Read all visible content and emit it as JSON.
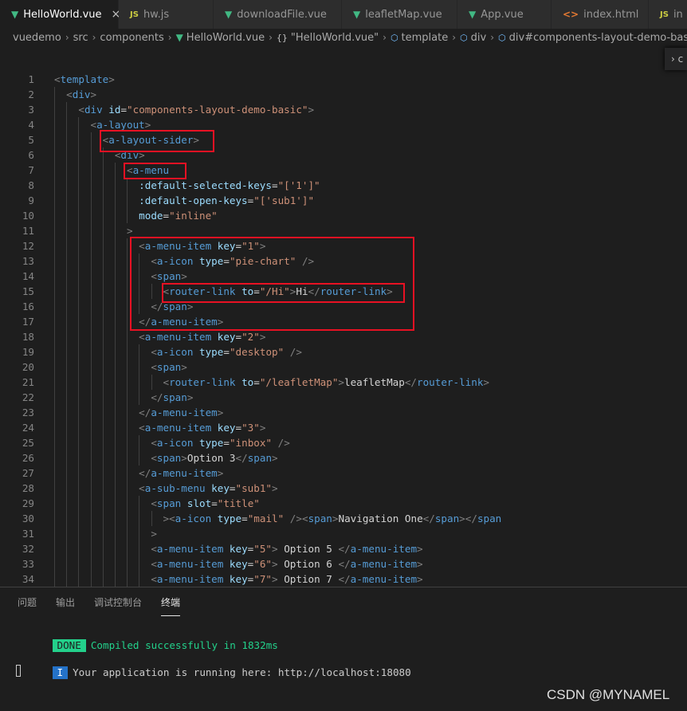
{
  "tabs": [
    {
      "label": "HelloWorld.vue",
      "icon": "vue-file-icon",
      "active": true
    },
    {
      "label": "hw.js",
      "icon": "js-file-icon",
      "active": false
    },
    {
      "label": "downloadFile.vue",
      "icon": "vue-file-icon",
      "active": false
    },
    {
      "label": "leafletMap.vue",
      "icon": "vue-file-icon",
      "active": false
    },
    {
      "label": "App.vue",
      "icon": "vue-file-icon",
      "active": false
    },
    {
      "label": "index.html",
      "icon": "html-file-icon",
      "active": false
    },
    {
      "label": "in",
      "icon": "js-file-icon",
      "active": false
    }
  ],
  "breadcrumb": {
    "items": [
      "vuedemo",
      "src",
      "components",
      "HelloWorld.vue",
      "\"HelloWorld.vue\"",
      "template",
      "div",
      "div#components-layout-demo-basic"
    ]
  },
  "sticky_widget": {
    "label": "c"
  },
  "editor": {
    "line_numbers": [
      "1",
      "2",
      "3",
      "4",
      "5",
      "6",
      "7",
      "8",
      "9",
      "10",
      "11",
      "12",
      "13",
      "14",
      "15",
      "16",
      "17",
      "18",
      "19",
      "20",
      "21",
      "22",
      "23",
      "24",
      "25",
      "26",
      "27",
      "28",
      "29",
      "30",
      "31",
      "32",
      "33",
      "34"
    ],
    "lines": [
      "<template>",
      "  <div>",
      "    <div id=\"components-layout-demo-basic\">",
      "      <a-layout>",
      "        <a-layout-sider>",
      "          <div>",
      "            <a-menu",
      "              :default-selected-keys=\"['1']\"",
      "              :default-open-keys=\"['sub1']\"",
      "              mode=\"inline\"",
      "            >",
      "              <a-menu-item key=\"1\">",
      "                <a-icon type=\"pie-chart\" />",
      "                <span>",
      "                  <router-link to=\"/Hi\">Hi</router-link>",
      "                </span>",
      "              </a-menu-item>",
      "              <a-menu-item key=\"2\">",
      "                <a-icon type=\"desktop\" />",
      "                <span>",
      "                  <router-link to=\"/leafletMap\">leafletMap</router-link>",
      "                </span>",
      "              </a-menu-item>",
      "              <a-menu-item key=\"3\">",
      "                <a-icon type=\"inbox\" />",
      "                <span>Option 3</span>",
      "              </a-menu-item>",
      "              <a-sub-menu key=\"sub1\">",
      "                <span slot=\"title\"",
      "                  ><a-icon type=\"mail\" /><span>Navigation One</span></span",
      "                >",
      "                <a-menu-item key=\"5\"> Option 5 </a-menu-item>",
      "                <a-menu-item key=\"6\"> Option 6 </a-menu-item>",
      "                <a-menu-item key=\"7\"> Option 7 </a-menu-item>"
    ]
  },
  "panel": {
    "tabs": [
      {
        "label": "问题",
        "active": false
      },
      {
        "label": "输出",
        "active": false
      },
      {
        "label": "调试控制台",
        "active": false
      },
      {
        "label": "终端",
        "active": true
      }
    ],
    "terminal": {
      "done_badge": "DONE",
      "done_message": "Compiled successfully in 1832ms",
      "info_badge": "I",
      "info_message": "Your application is running here: http://localhost:18080"
    }
  },
  "watermark": "CSDN @MYNAMEL",
  "colors": {
    "background": "#1e1e1e",
    "tag": "#569cd6",
    "attribute": "#9cdcfe",
    "string": "#ce9178",
    "highlight_box": "#e81123",
    "terminal_green": "#23d18b"
  }
}
